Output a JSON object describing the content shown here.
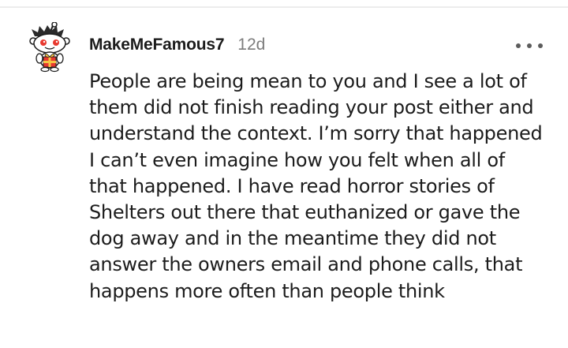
{
  "comment": {
    "username": "MakeMeFamous7",
    "age": "12d",
    "avatar_icon": "snoo-avatar-icon",
    "more_icon": "more-options-icon",
    "body": "People are being mean to you and I see a lot of them did not finish reading your post either and understand the context. I’m sorry that happened I can’t even imagine how you felt when all of that happened. I have read horror stories of Shelters out there that euthanized or gave the dog away and in the meantime they did not answer the owners email and phone calls, that happens more often than people think"
  },
  "colors": {
    "text": "#1c1c1c",
    "meta": "#7c7c7c",
    "divider": "#ececec",
    "avatar_red": "#e8392f"
  }
}
